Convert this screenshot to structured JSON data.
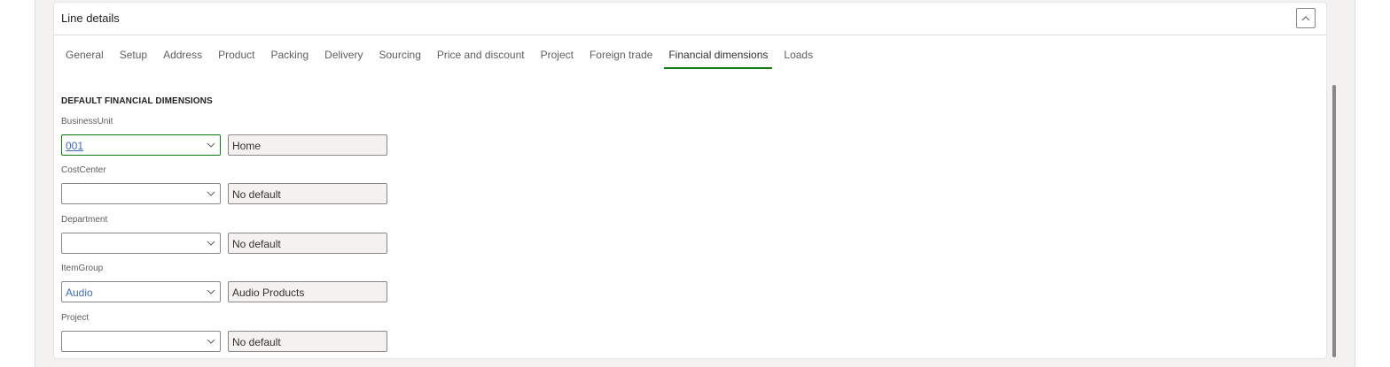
{
  "card": {
    "title": "Line details",
    "collapse_icon": "chevron-up-icon"
  },
  "tabs": [
    {
      "label": "General",
      "active": false
    },
    {
      "label": "Setup",
      "active": false
    },
    {
      "label": "Address",
      "active": false
    },
    {
      "label": "Product",
      "active": false
    },
    {
      "label": "Packing",
      "active": false
    },
    {
      "label": "Delivery",
      "active": false
    },
    {
      "label": "Sourcing",
      "active": false
    },
    {
      "label": "Price and discount",
      "active": false
    },
    {
      "label": "Project",
      "active": false
    },
    {
      "label": "Foreign trade",
      "active": false
    },
    {
      "label": "Financial dimensions",
      "active": true
    },
    {
      "label": "Loads",
      "active": false
    }
  ],
  "section": {
    "title": "DEFAULT FINANCIAL DIMENSIONS"
  },
  "fields": [
    {
      "label": "BusinessUnit",
      "value": "001",
      "description": "Home"
    },
    {
      "label": "CostCenter",
      "value": "",
      "description": "No default"
    },
    {
      "label": "Department",
      "value": "",
      "description": "No default"
    },
    {
      "label": "ItemGroup",
      "value": "Audio",
      "description": "Audio Products"
    },
    {
      "label": "Project",
      "value": "",
      "description": "No default"
    }
  ],
  "colors": {
    "accent": "#107c10",
    "link": "#3f6db8",
    "readonly_bg": "#f3f2f1"
  }
}
